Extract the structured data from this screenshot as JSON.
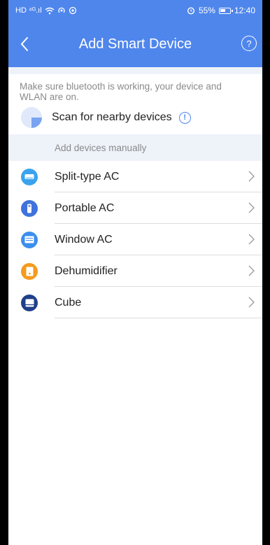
{
  "status": {
    "left_icons": "HD ⁴ᴳ.ıl",
    "time": "12:40",
    "battery": "55%"
  },
  "appbar": {
    "title": "Add Smart Device"
  },
  "info": {
    "message": "Make sure bluetooth is working, your device and WLAN are on."
  },
  "scan": {
    "label": "Scan for nearby devices"
  },
  "manual": {
    "header": "Add devices manually"
  },
  "devices": [
    {
      "label": "Split-type AC",
      "icon": "split-ac-icon",
      "color": "#3aa3ee"
    },
    {
      "label": "Portable AC",
      "icon": "portable-ac-icon",
      "color": "#3f72dd"
    },
    {
      "label": "Window AC",
      "icon": "window-ac-icon",
      "color": "#3c8fec"
    },
    {
      "label": "Dehumidifier",
      "icon": "dehumidifier-icon",
      "color": "#f59b1e"
    },
    {
      "label": "Cube",
      "icon": "cube-icon",
      "color": "#1f3f8a"
    }
  ],
  "colors": {
    "primary": "#4f86ec",
    "section_bg": "#eef2f9"
  }
}
